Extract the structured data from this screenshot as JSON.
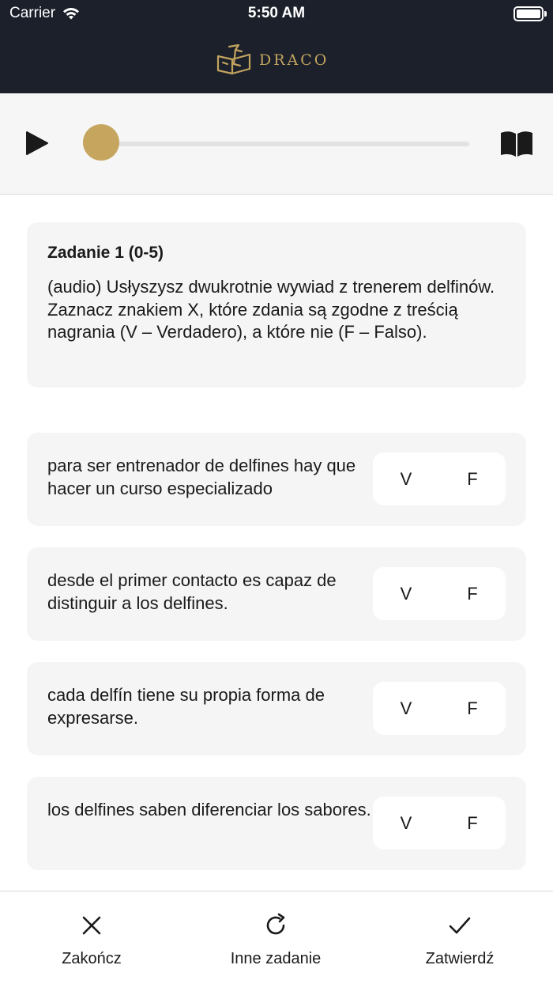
{
  "status_bar": {
    "carrier": "Carrier",
    "time": "5:50 AM"
  },
  "header": {
    "logo_text": "DRACO",
    "logo_color": "#c3a45f",
    "background": "#1b202b"
  },
  "player": {
    "play_icon": "play-icon",
    "book_icon": "book-icon",
    "progress": 0,
    "accent": "#c6a55f"
  },
  "task": {
    "title": "Zadanie 1 (0-5)",
    "instruction": "(audio) Usłyszysz dwukrotnie wywiad z trenerem delfinów. Zaznacz znakiem X, które zdania są zgodne z treścią nagrania (V – Verdadero), a które nie (F – Falso)."
  },
  "questions": [
    {
      "text": "para ser entrenador de delfines hay que hacer un curso especializado",
      "v_label": "V",
      "f_label": "F"
    },
    {
      "text": "desde el primer contacto es capaz de distinguir a los delfines.",
      "v_label": "V",
      "f_label": "F"
    },
    {
      "text": "cada delfín tiene su propia forma de expresarse.",
      "v_label": "V",
      "f_label": "F"
    },
    {
      "text": "los delfines saben diferenciar los sabores.",
      "v_label": "V",
      "f_label": "F"
    }
  ],
  "bottom_bar": {
    "finish_label": "Zakończ",
    "other_task_label": "Inne zadanie",
    "confirm_label": "Zatwierdź"
  }
}
